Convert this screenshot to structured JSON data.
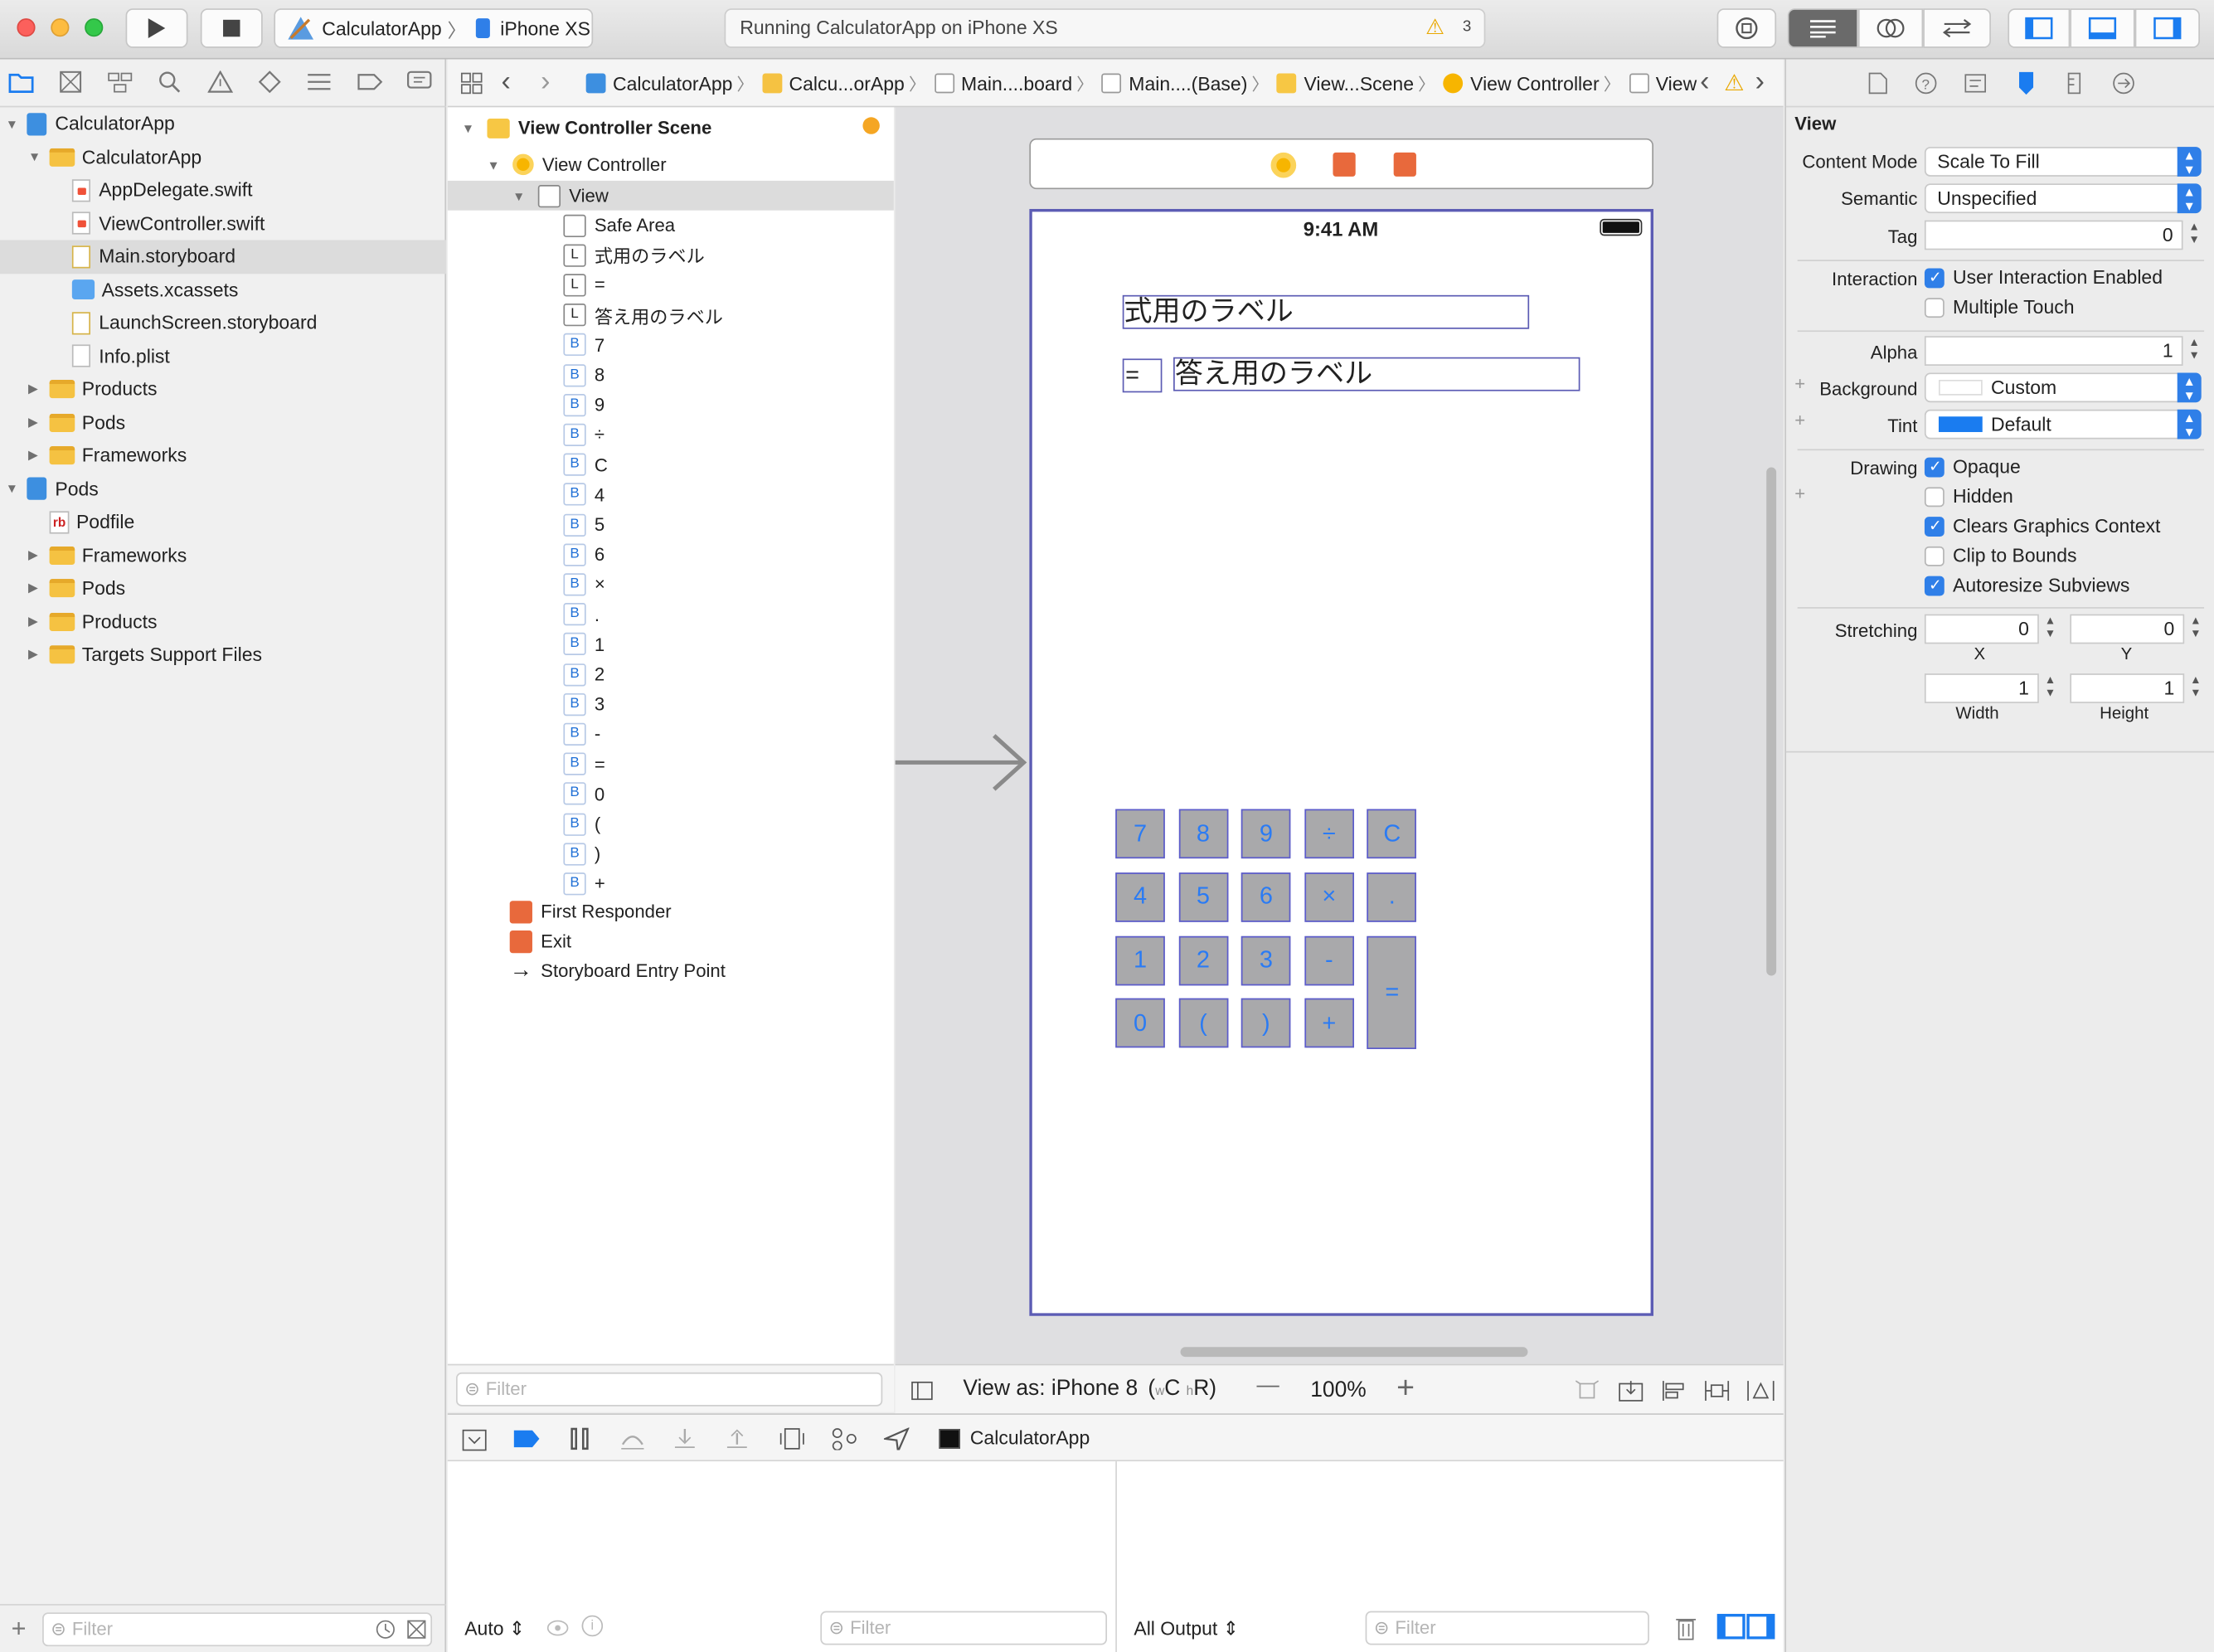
{
  "toolbar": {
    "scheme_app": "CalculatorApp",
    "scheme_sep": "〉",
    "device": "iPhone XS",
    "status": "Running CalculatorApp on iPhone XS",
    "warning_count": "3",
    "warning_icon": "⚠"
  },
  "navigator": {
    "items": [
      {
        "label": "CalculatorApp",
        "level": 0,
        "icon": "project-icon",
        "open": true
      },
      {
        "label": "CalculatorApp",
        "level": 1,
        "icon": "folder-icon",
        "open": true
      },
      {
        "label": "AppDelegate.swift",
        "level": 2,
        "icon": "swift-file-icon"
      },
      {
        "label": "ViewController.swift",
        "level": 2,
        "icon": "swift-file-icon"
      },
      {
        "label": "Main.storyboard",
        "level": 2,
        "icon": "storyboard-icon",
        "selected": true
      },
      {
        "label": "Assets.xcassets",
        "level": 2,
        "icon": "asset-catalog-icon"
      },
      {
        "label": "LaunchScreen.storyboard",
        "level": 2,
        "icon": "storyboard-icon"
      },
      {
        "label": "Info.plist",
        "level": 2,
        "icon": "plist-icon"
      },
      {
        "label": "Products",
        "level": 1,
        "icon": "folder-icon",
        "open": false
      },
      {
        "label": "Pods",
        "level": 1,
        "icon": "folder-icon",
        "open": false
      },
      {
        "label": "Frameworks",
        "level": 1,
        "icon": "folder-icon",
        "open": false
      },
      {
        "label": "Pods",
        "level": 0,
        "icon": "project-icon",
        "open": true
      },
      {
        "label": "Podfile",
        "level": 1,
        "icon": "ruby-file-icon"
      },
      {
        "label": "Frameworks",
        "level": 1,
        "icon": "folder-icon",
        "open": false
      },
      {
        "label": "Pods",
        "level": 1,
        "icon": "folder-icon",
        "open": false
      },
      {
        "label": "Products",
        "level": 1,
        "icon": "folder-icon",
        "open": false
      },
      {
        "label": "Targets Support Files",
        "level": 1,
        "icon": "folder-icon",
        "open": false
      }
    ],
    "filter_placeholder": "Filter"
  },
  "jumpbar": {
    "crumbs": [
      "CalculatorApp",
      "Calcu...orApp",
      "Main....board",
      "Main....(Base)",
      "View...Scene",
      "View Controller",
      "View"
    ]
  },
  "outline": {
    "scene_title": "View Controller Scene",
    "controller": "View Controller",
    "view": "View",
    "children": [
      {
        "badge": "",
        "label": "Safe Area"
      },
      {
        "badge": "L",
        "label": "式用のラベル"
      },
      {
        "badge": "L",
        "label": "="
      },
      {
        "badge": "L",
        "label": "答え用のラベル"
      },
      {
        "badge": "B",
        "label": "7"
      },
      {
        "badge": "B",
        "label": "8"
      },
      {
        "badge": "B",
        "label": "9"
      },
      {
        "badge": "B",
        "label": "÷"
      },
      {
        "badge": "B",
        "label": "C"
      },
      {
        "badge": "B",
        "label": "4"
      },
      {
        "badge": "B",
        "label": "5"
      },
      {
        "badge": "B",
        "label": "6"
      },
      {
        "badge": "B",
        "label": "×"
      },
      {
        "badge": "B",
        "label": "."
      },
      {
        "badge": "B",
        "label": "1"
      },
      {
        "badge": "B",
        "label": "2"
      },
      {
        "badge": "B",
        "label": "3"
      },
      {
        "badge": "B",
        "label": "-"
      },
      {
        "badge": "B",
        "label": "="
      },
      {
        "badge": "B",
        "label": "0"
      },
      {
        "badge": "B",
        "label": "("
      },
      {
        "badge": "B",
        "label": ")"
      },
      {
        "badge": "B",
        "label": "+"
      }
    ],
    "first_responder": "First Responder",
    "exit": "Exit",
    "entry_point": "Storyboard Entry Point",
    "filter_placeholder": "Filter"
  },
  "canvas": {
    "status_time": "9:41 AM",
    "expr_label": "式用のラベル",
    "equals_label": "=",
    "answer_label": "答え用のラベル",
    "keys": [
      "7",
      "8",
      "9",
      "÷",
      "C",
      "4",
      "5",
      "6",
      "×",
      ".",
      "1",
      "2",
      "3",
      "-",
      "=",
      "0",
      "(",
      ")",
      "+"
    ],
    "view_as": "View as: iPhone 8",
    "size_class_w": "w",
    "size_class_w_val": "C",
    "size_class_h": "h",
    "size_class_h_val": "R",
    "zoom_minus": "—",
    "zoom": "100%",
    "zoom_plus": "+"
  },
  "debug": {
    "target": "CalculatorApp",
    "auto": "Auto",
    "output": "All Output",
    "filter_placeholder": "Filter"
  },
  "inspector": {
    "section": "View",
    "content_mode_label": "Content Mode",
    "content_mode": "Scale To Fill",
    "semantic_label": "Semantic",
    "semantic": "Unspecified",
    "tag_label": "Tag",
    "tag": "0",
    "interaction_label": "Interaction",
    "user_interaction": "User Interaction Enabled",
    "multiple_touch": "Multiple Touch",
    "alpha_label": "Alpha",
    "alpha": "1",
    "background_label": "Background",
    "background": "Custom",
    "tint_label": "Tint",
    "tint": "Default",
    "drawing_label": "Drawing",
    "opaque": "Opaque",
    "hidden": "Hidden",
    "clears": "Clears Graphics Context",
    "clip": "Clip to Bounds",
    "autoresize": "Autoresize Subviews",
    "stretching_label": "Stretching",
    "sx": "0",
    "sy": "0",
    "x_label": "X",
    "y_label": "Y",
    "sw": "1",
    "sh": "1",
    "w_label": "Width",
    "h_label": "Height",
    "tint_color": "#1a7cf0"
  },
  "colors": {
    "accent": "#2f7fe8",
    "key_fill": "#a9a9ab",
    "key_border": "#5c5ccc",
    "key_text": "#2a7bf4"
  }
}
